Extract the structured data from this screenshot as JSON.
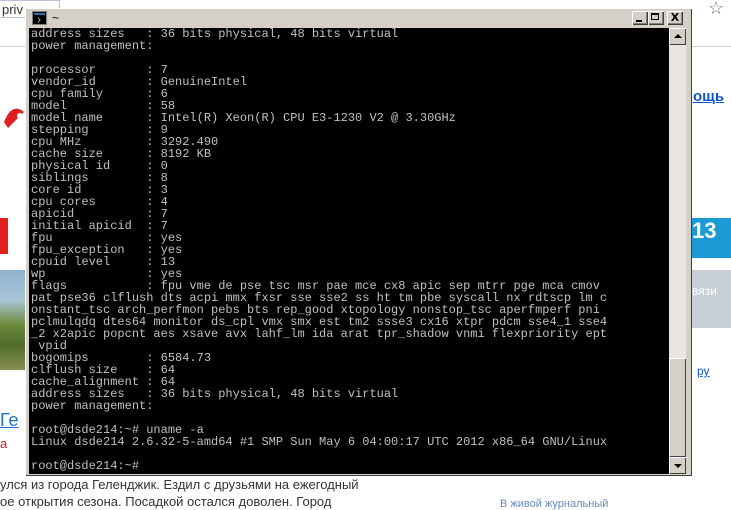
{
  "background": {
    "url_fragment": "priv",
    "help_link": "ощь",
    "blue_banner_text": "13",
    "grey_banner_text": "вязи",
    "ru_link": "ру",
    "ge_link": "Ге",
    "red_fragment": "а",
    "article_line1": "улся из города Геленджик. Ездил с друзьями на ежегодный",
    "article_line2": "ое открытия сезона. Посадкой остался доволен. Город",
    "bottom_link": "В живой журнальный"
  },
  "terminal": {
    "title": "~",
    "buttons": {
      "minimize": "_",
      "maximize": "□",
      "close": "X"
    },
    "lines": [
      "address sizes   : 36 bits physical, 48 bits virtual",
      "power management:",
      "",
      "processor       : 7",
      "vendor_id       : GenuineIntel",
      "cpu family      : 6",
      "model           : 58",
      "model name      : Intel(R) Xeon(R) CPU E3-1230 V2 @ 3.30GHz",
      "stepping        : 9",
      "cpu MHz         : 3292.490",
      "cache size      : 8192 KB",
      "physical id     : 0",
      "siblings        : 8",
      "core id         : 3",
      "cpu cores       : 4",
      "apicid          : 7",
      "initial apicid  : 7",
      "fpu             : yes",
      "fpu_exception   : yes",
      "cpuid level     : 13",
      "wp              : yes",
      "flags           : fpu vme de pse tsc msr pae mce cx8 apic sep mtrr pge mca cmov",
      "pat pse36 clflush dts acpi mmx fxsr sse sse2 ss ht tm pbe syscall nx rdtscp lm c",
      "onstant_tsc arch_perfmon pebs bts rep_good xtopology nonstop_tsc aperfmperf pni",
      "pclmulqdq dtes64 monitor ds_cpl vmx smx est tm2 ssse3 cx16 xtpr pdcm sse4_1 sse4",
      "_2 x2apic popcnt aes xsave avx lahf_lm ida arat tpr_shadow vnmi flexpriority ept",
      " vpid",
      "bogomips        : 6584.73",
      "clflush size    : 64",
      "cache_alignment : 64",
      "address sizes   : 36 bits physical, 48 bits virtual",
      "power management:",
      "",
      "root@dsde214:~# uname -a",
      "Linux dsde214 2.6.32-5-amd64 #1 SMP Sun May 6 04:00:17 UTC 2012 x86_64 GNU/Linux",
      "",
      "root@dsde214:~#"
    ],
    "scroll_position": 0.95
  }
}
